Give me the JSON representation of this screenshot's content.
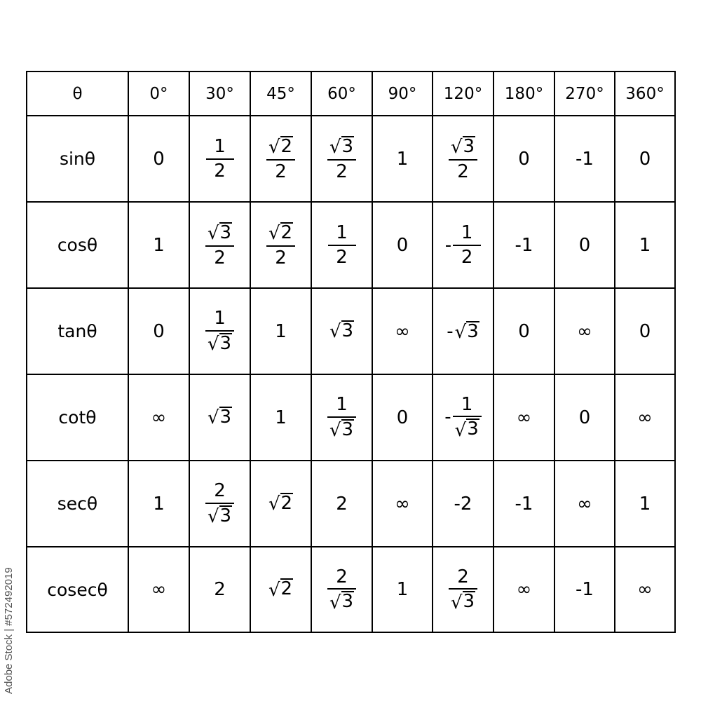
{
  "table": {
    "corner": "θ",
    "angles": [
      "0°",
      "30°",
      "45°",
      "60°",
      "90°",
      "120°",
      "180°",
      "270°",
      "360°"
    ],
    "rows": [
      {
        "label": "sinθ",
        "values": [
          {
            "t": "n",
            "v": "0"
          },
          {
            "t": "f",
            "num": "1",
            "den": "2"
          },
          {
            "t": "f",
            "num": "√2",
            "den": "2"
          },
          {
            "t": "f",
            "num": "√3",
            "den": "2"
          },
          {
            "t": "n",
            "v": "1"
          },
          {
            "t": "f",
            "num": "√3",
            "den": "2"
          },
          {
            "t": "n",
            "v": "0"
          },
          {
            "t": "n",
            "v": "-1"
          },
          {
            "t": "n",
            "v": "0"
          }
        ]
      },
      {
        "label": "cosθ",
        "values": [
          {
            "t": "n",
            "v": "1"
          },
          {
            "t": "f",
            "num": "√3",
            "den": "2"
          },
          {
            "t": "f",
            "num": "√2",
            "den": "2"
          },
          {
            "t": "f",
            "num": "1",
            "den": "2"
          },
          {
            "t": "n",
            "v": "0"
          },
          {
            "t": "f",
            "num": "1",
            "den": "2",
            "neg": true
          },
          {
            "t": "n",
            "v": "-1"
          },
          {
            "t": "n",
            "v": "0"
          },
          {
            "t": "n",
            "v": "1"
          }
        ]
      },
      {
        "label": "tanθ",
        "values": [
          {
            "t": "n",
            "v": "0"
          },
          {
            "t": "f",
            "num": "1",
            "den": "√3"
          },
          {
            "t": "n",
            "v": "1"
          },
          {
            "t": "n",
            "v": "√3"
          },
          {
            "t": "n",
            "v": "∞"
          },
          {
            "t": "n",
            "v": "-√3"
          },
          {
            "t": "n",
            "v": "0"
          },
          {
            "t": "n",
            "v": "∞"
          },
          {
            "t": "n",
            "v": "0"
          }
        ]
      },
      {
        "label": "cotθ",
        "values": [
          {
            "t": "n",
            "v": "∞"
          },
          {
            "t": "n",
            "v": "√3"
          },
          {
            "t": "n",
            "v": "1"
          },
          {
            "t": "f",
            "num": "1",
            "den": "√3"
          },
          {
            "t": "n",
            "v": "0"
          },
          {
            "t": "f",
            "num": "1",
            "den": "√3",
            "neg": true
          },
          {
            "t": "n",
            "v": "∞"
          },
          {
            "t": "n",
            "v": "0"
          },
          {
            "t": "n",
            "v": "∞"
          }
        ]
      },
      {
        "label": "secθ",
        "values": [
          {
            "t": "n",
            "v": "1"
          },
          {
            "t": "f",
            "num": "2",
            "den": "√3"
          },
          {
            "t": "n",
            "v": "√2"
          },
          {
            "t": "n",
            "v": "2"
          },
          {
            "t": "n",
            "v": "∞"
          },
          {
            "t": "n",
            "v": "-2"
          },
          {
            "t": "n",
            "v": "-1"
          },
          {
            "t": "n",
            "v": "∞"
          },
          {
            "t": "n",
            "v": "1"
          }
        ]
      },
      {
        "label": "cosecθ",
        "values": [
          {
            "t": "n",
            "v": "∞"
          },
          {
            "t": "n",
            "v": "2"
          },
          {
            "t": "n",
            "v": "√2"
          },
          {
            "t": "f",
            "num": "2",
            "den": "√3"
          },
          {
            "t": "n",
            "v": "1"
          },
          {
            "t": "f",
            "num": "2",
            "den": "√3"
          },
          {
            "t": "n",
            "v": "∞"
          },
          {
            "t": "n",
            "v": "-1"
          },
          {
            "t": "n",
            "v": "∞"
          }
        ]
      }
    ]
  },
  "watermark": "Adobe Stock | #572492019"
}
